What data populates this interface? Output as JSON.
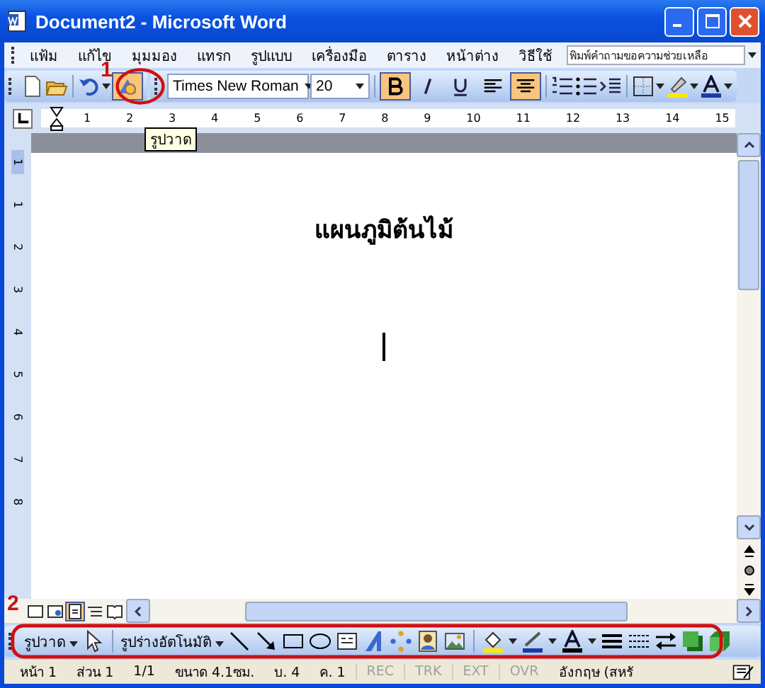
{
  "window": {
    "title": "Document2 - Microsoft Word"
  },
  "menu": [
    {
      "label": "แฟ้ม"
    },
    {
      "label": "แก้ไข"
    },
    {
      "label": "มุมมอง"
    },
    {
      "label": "แทรก"
    },
    {
      "label": "รูปแบบ"
    },
    {
      "label": "เครื่องมือ"
    },
    {
      "label": "ตาราง"
    },
    {
      "label": "หน้าต่าง"
    },
    {
      "label": "วิธีใช้"
    }
  ],
  "help_box": {
    "placeholder": "พิมพ์คำถามขอความช่วยเหลือ"
  },
  "toolbar": {
    "drawing_button_selected": true,
    "font": "Times New Roman",
    "size": "20",
    "format_buttons": [
      {
        "kind": "bold",
        "selected": true
      },
      {
        "kind": "italic",
        "selected": false
      },
      {
        "kind": "underline",
        "selected": false
      },
      {
        "kind": "align-left",
        "selected": false
      },
      {
        "kind": "align-center",
        "selected": true
      }
    ]
  },
  "tooltip": "รูปวาด",
  "ruler": {
    "numbers": [
      "1",
      "2",
      "3",
      "4",
      "5",
      "6",
      "7",
      "8",
      "9",
      "10",
      "11",
      "12",
      "13",
      "14",
      "15"
    ]
  },
  "vertical_ruler": {
    "numbers": [
      "1",
      "1",
      "2",
      "3",
      "4",
      "5",
      "6",
      "7",
      "8"
    ]
  },
  "document": {
    "heading": "แผนภูมิต้นไม้"
  },
  "annotations": [
    {
      "label": "1"
    },
    {
      "label": "2"
    }
  ],
  "drawing_toolbar": {
    "menu": "รูปวาด",
    "autoshapes": "รูปร่างอัตโนมัติ"
  },
  "status_bar": [
    {
      "text": "หน้า 1",
      "disabled": false
    },
    {
      "text": "ส่วน 1",
      "disabled": false
    },
    {
      "text": "1/1",
      "disabled": false
    },
    {
      "text": "ขนาด 4.1ซม.",
      "disabled": false
    },
    {
      "text": "บ. 4",
      "disabled": false
    },
    {
      "text": "ค. 1",
      "disabled": false
    },
    {
      "text": "REC",
      "disabled": true
    },
    {
      "text": "TRK",
      "disabled": true
    },
    {
      "text": "EXT",
      "disabled": true
    },
    {
      "text": "OVR",
      "disabled": true
    },
    {
      "text": "อังกฤษ (สหรั",
      "disabled": false
    }
  ]
}
